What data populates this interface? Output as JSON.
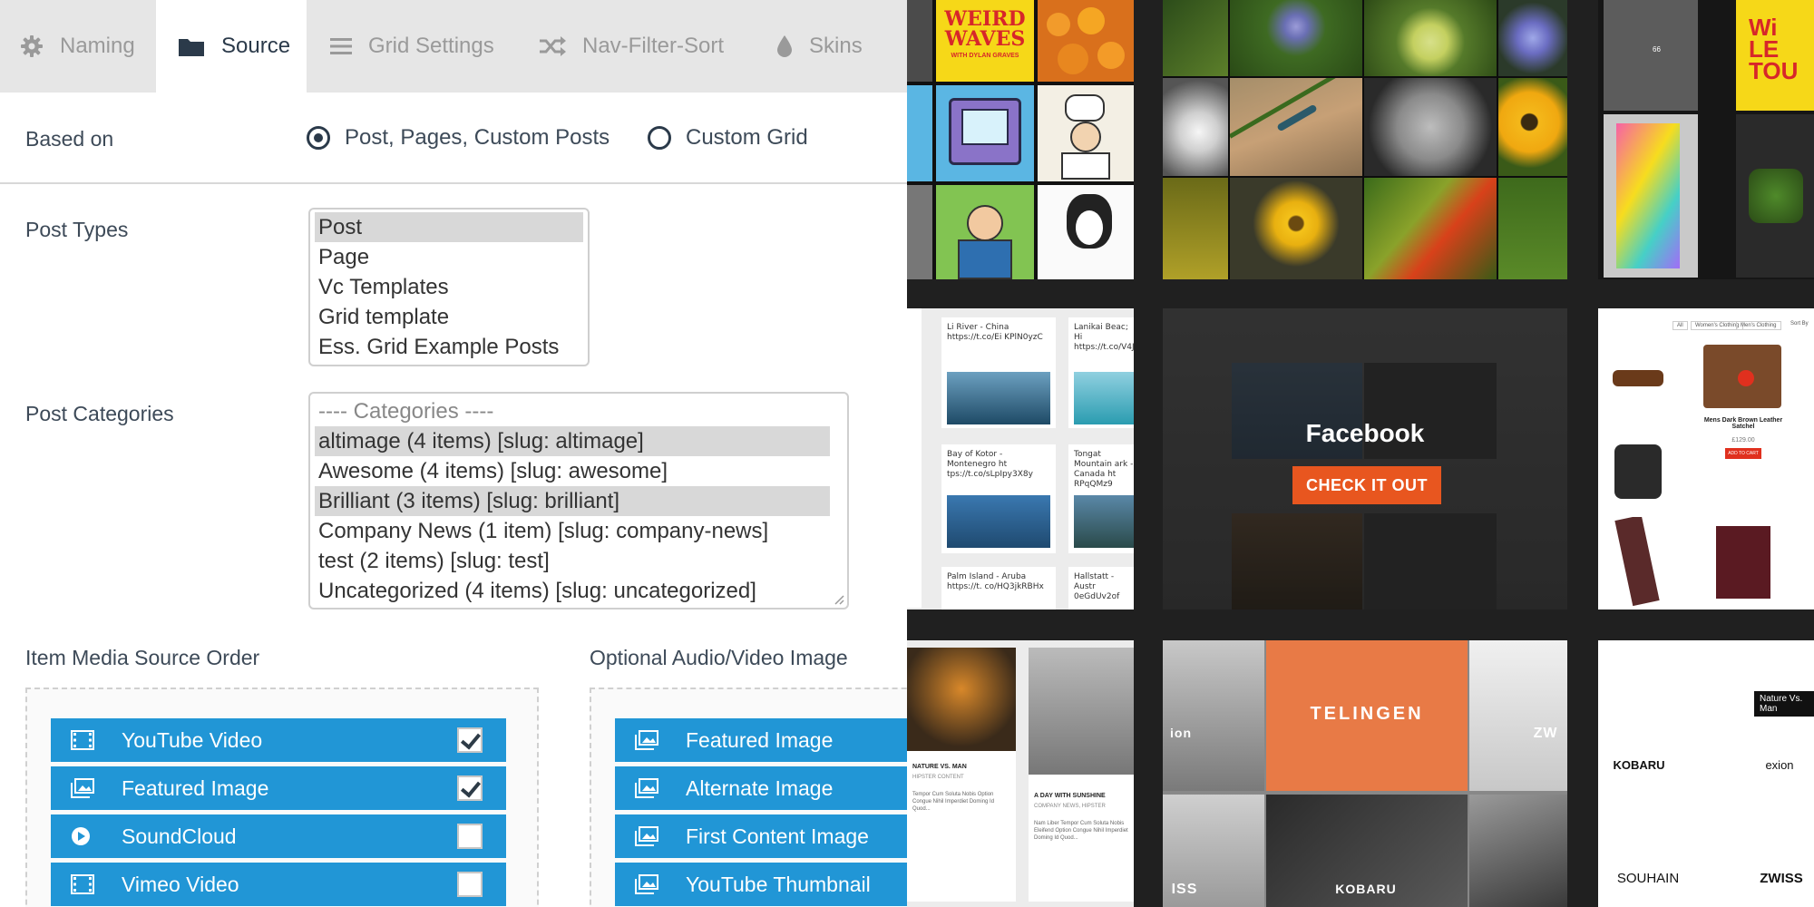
{
  "tabs": [
    {
      "label": "Naming",
      "icon": "gear-icon"
    },
    {
      "label": "Source",
      "icon": "folder-icon"
    },
    {
      "label": "Grid Settings",
      "icon": "menu-icon"
    },
    {
      "label": "Nav-Filter-Sort",
      "icon": "shuffle-icon"
    },
    {
      "label": "Skins",
      "icon": "drop-icon"
    }
  ],
  "active_tab": "Source",
  "based_on": {
    "label": "Based on",
    "options": [
      "Post, Pages, Custom Posts",
      "Custom Grid"
    ],
    "selected": "Post, Pages, Custom Posts"
  },
  "post_types": {
    "label": "Post Types",
    "options": [
      "Post",
      "Page",
      "Vc Templates",
      "Grid template",
      "Ess. Grid Example Posts"
    ],
    "selected": [
      "Post"
    ]
  },
  "post_categories": {
    "label": "Post Categories",
    "options": [
      "---- Categories ----",
      "altimage (4 items) [slug: altimage]",
      "Awesome (4 items) [slug: awesome]",
      "Brilliant (3 items) [slug: brilliant]",
      "Company News (1 item) [slug: company-news]",
      "test (2 items) [slug: test]",
      "Uncategorized (4 items) [slug: uncategorized]"
    ],
    "selected": [
      "altimage (4 items) [slug: altimage]",
      "Brilliant (3 items) [slug: brilliant]"
    ]
  },
  "media_source": {
    "label": "Item Media Source Order",
    "items": [
      {
        "label": "YouTube Video",
        "icon": "film-icon",
        "checked": true
      },
      {
        "label": "Featured Image",
        "icon": "image-icon",
        "checked": true
      },
      {
        "label": "SoundCloud",
        "icon": "play-icon",
        "checked": false
      },
      {
        "label": "Vimeo Video",
        "icon": "film-icon",
        "checked": false
      }
    ]
  },
  "audio_video_image": {
    "label": "Optional Audio/Video Image",
    "items": [
      {
        "label": "Featured Image",
        "icon": "image-icon"
      },
      {
        "label": "Alternate Image",
        "icon": "image-icon"
      },
      {
        "label": "First Content Image",
        "icon": "image-icon"
      },
      {
        "label": "YouTube Thumbnail",
        "icon": "image-icon"
      }
    ]
  },
  "showcase": {
    "facebook_title": "Facebook",
    "facebook_button": "CHECK IT OUT",
    "weird_waves_title": "WEIRD WAVES",
    "weird_waves_sub": "WITH DYLAN GRAVES",
    "tweets": [
      "Li River - China https://t.co/Ei KPlN0yzC",
      "Lanikai Beac; Hi https://t.co/V4JhA",
      "Bay of Kotor - Montenegro ht tps://t.co/sLpIpy3X8y",
      "Tongat Mountain ark - Canada ht RPqQMz9",
      "Palm Island - Aruba https://t. co/HQ3jkRBHx",
      "Hallstatt - Austr 0eGdUv2of"
    ],
    "shop_filters": [
      "All",
      "Women's Clothing",
      "Men's Clothing",
      "Sort By"
    ],
    "product_name": "Mens Dark Brown Leather Satchel",
    "product_price": "£129.00",
    "product_button": "ADD TO CART",
    "blog_titles": [
      "NATURE VS. MAN",
      "A DAY WITH SUNSHINE"
    ],
    "blog_subtitles": [
      "HIPSTER CONTENT",
      "COMPANY NEWS, HIPSTER"
    ],
    "blog_excerpts": [
      "Tempor Cum Soluta Nobis Option Congue Nihil Imperdiet Doming Id Quod...",
      "Nam Liber Tempor Cum Soluta Nobis Eleifend Option Congue Nihil Imperdiet Doming Id Quod..."
    ],
    "brands": [
      "TELINGEN",
      "ZWISS",
      "KOBARU",
      "SOUHAIN",
      "exion",
      "ion",
      "ZW",
      "ISS"
    ],
    "brand_tooltip": "Nature Vs. Man",
    "stat_label": "66"
  },
  "colors": {
    "accent_blue": "#2196d6",
    "accent_orange": "#e8561f",
    "dark_text": "#2b3a4a",
    "tab_bar": "#e6e6e6"
  }
}
